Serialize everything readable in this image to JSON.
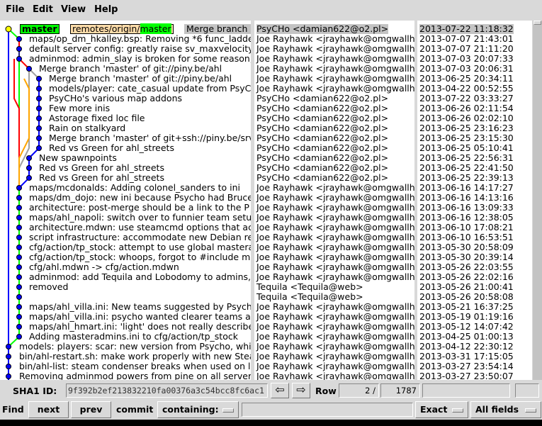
{
  "menu": [
    "File",
    "Edit",
    "View",
    "Help"
  ],
  "refs": {
    "head": "master",
    "remote_prefix": "remotes/origin/",
    "remote_branch": "master"
  },
  "commits": [
    {
      "subject": "Merge branch 'master' of piny.be:ahl",
      "author": "PsyCHo <damian622@o2.pl>",
      "date": "2013-07-22 11:18:32"
    },
    {
      "subject": "maps/op_dm_hkalley.bsp: Removing *6 func_ladder",
      "author": "Joe Rayhawk <jrayhawk@omgwallhack.org>",
      "date": "2013-07-07 21:43:01"
    },
    {
      "subject": "default server config: greatly raise sv_maxvelocity",
      "author": "Joe Rayhawk <jrayhawk@omgwallhack.org>",
      "date": "2013-07-07 21:11:20"
    },
    {
      "subject": "adminmod: admin_slay is broken for some reason;",
      "author": "Joe Rayhawk <jrayhawk@omgwallhack.org>",
      "date": "2013-07-03 20:07:33"
    },
    {
      "subject": "Merge branch 'master' of git://piny.be/ahl",
      "author": "Joe Rayhawk <jrayhawk@omgwallhack.org>",
      "date": "2013-07-03 20:06:31"
    },
    {
      "subject": "Merge branch 'master' of git://piny.be/ahl",
      "author": "Joe Rayhawk <jrayhawk@omgwallhack.org>",
      "date": "2013-06-25 20:34:11"
    },
    {
      "subject": "models/player: cate_casual update from PsyCHo",
      "author": "Joe Rayhawk <jrayhawk@omgwallhack.org>",
      "date": "2013-04-22 00:52:55"
    },
    {
      "subject": "PsyCHo's various map addons",
      "author": "PsyCHo <damian622@o2.pl>",
      "date": "2013-07-22 03:33:27"
    },
    {
      "subject": "Few more inis",
      "author": "PsyCHo <damian622@o2.pl>",
      "date": "2013-06-26 02:11:54"
    },
    {
      "subject": "Astorage fixed loc file",
      "author": "PsyCHo <damian622@o2.pl>",
      "date": "2013-06-26 02:02:10"
    },
    {
      "subject": "Rain on stalkyard",
      "author": "PsyCHo <damian622@o2.pl>",
      "date": "2013-06-25 23:16:23"
    },
    {
      "subject": "Merge branch 'master' of git+ssh://piny.be/srv",
      "author": "PsyCHo <damian622@o2.pl>",
      "date": "2013-06-25 23:15:30"
    },
    {
      "subject": "Red vs Green for ahl_streets",
      "author": "PsyCHo <damian622@o2.pl>",
      "date": "2013-06-25 05:10:41"
    },
    {
      "subject": "New spawnpoints",
      "author": "PsyCHo <damian622@o2.pl>",
      "date": "2013-06-25 22:56:31"
    },
    {
      "subject": "Red vs Green for ahl_streets",
      "author": "PsyCHo <damian622@o2.pl>",
      "date": "2013-06-25 22:41:50"
    },
    {
      "subject": "Red vs Green for ahl_streets",
      "author": "PsyCHo <damian622@o2.pl>",
      "date": "2013-06-25 22:39:13"
    },
    {
      "subject": "maps/mcdonalds: Adding colonel_sanders to ini",
      "author": "Joe Rayhawk <jrayhawk@omgwallhack.org>",
      "date": "2013-06-16 14:17:27"
    },
    {
      "subject": "maps/dm_dojo: new ini because Psycho had Bruce",
      "author": "Joe Rayhawk <jrayhawk@omgwallhack.org>",
      "date": "2013-06-16 14:13:16"
    },
    {
      "subject": "architecture: post-merge should be a link to the P",
      "author": "Joe Rayhawk <jrayhawk@omgwallhack.org>",
      "date": "2013-06-16 13:09:33"
    },
    {
      "subject": "maps/ahl_napoli: switch over to funnier team setup",
      "author": "Joe Rayhawk <jrayhawk@omgwallhack.org>",
      "date": "2013-06-16 12:38:05"
    },
    {
      "subject": "architecture.mdwn: use steamcmd options that ac",
      "author": "Joe Rayhawk <jrayhawk@omgwallhack.org>",
      "date": "2013-06-10 17:08:21"
    },
    {
      "subject": "script infrastructure: accommodate new Debian re",
      "author": "Joe Rayhawk <jrayhawk@omgwallhack.org>",
      "date": "2013-06-10 16:53:51"
    },
    {
      "subject": "cfg/action/tp_stock: attempt to use global mastera",
      "author": "Joe Rayhawk <jrayhawk@omgwallhack.org>",
      "date": "2013-05-30 20:58:09"
    },
    {
      "subject": "cfg/action/tp_stock: whoops, forgot to #include m",
      "author": "Joe Rayhawk <jrayhawk@omgwallhack.org>",
      "date": "2013-05-30 20:39:14"
    },
    {
      "subject": "cfg/ahl.mdwn -> cfg/action.mdwn",
      "author": "Joe Rayhawk <jrayhawk@omgwallhack.org>",
      "date": "2013-05-26 22:03:55"
    },
    {
      "subject": "adminmod: add Tequila and Lobodomy to admins,",
      "author": "Joe Rayhawk <jrayhawk@omgwallhack.org>",
      "date": "2013-05-26 22:02:16"
    },
    {
      "subject": "removed",
      "author": "Tequila <Tequila@web>",
      "date": "2013-05-26 21:00:41"
    },
    {
      "subject": "",
      "author": "Tequila <Tequila@web>",
      "date": "2013-05-26 20:58:08"
    },
    {
      "subject": "maps/ahl_villa.ini: New teams suggested by Psycho",
      "author": "Joe Rayhawk <jrayhawk@omgwallhack.org>",
      "date": "2013-05-21 16:37:25"
    },
    {
      "subject": "maps/ahl_villa.ini: psycho wanted clearer teams ar",
      "author": "Joe Rayhawk <jrayhawk@omgwallhack.org>",
      "date": "2013-05-19 01:19:16"
    },
    {
      "subject": "maps/ahl_hmart.ini: 'light' does not really describe",
      "author": "Joe Rayhawk <jrayhawk@omgwallhack.org>",
      "date": "2013-05-12 14:07:42"
    },
    {
      "subject": "Adding masteradmins.ini to cfg/action/tp_stock",
      "author": "Joe Rayhawk <jrayhawk@omgwallhack.org>",
      "date": "2013-04-25 01:00:13"
    },
    {
      "subject": "models: players: scar: new version from Psycho, which",
      "author": "Joe Rayhawk <jrayhawk@omgwallhack.org>",
      "date": "2013-04-12 22:30:12"
    },
    {
      "subject": "bin/ahl-restart.sh: make work properly with new Steam",
      "author": "Joe Rayhawk <jrayhawk@omgwallhack.org>",
      "date": "2013-03-31 17:15:05"
    },
    {
      "subject": "bin/ahl-list: steam condenser breaks when used on l",
      "author": "Joe Rayhawk <jrayhawk@omgwallhack.org>",
      "date": "2013-03-27 23:54:14"
    },
    {
      "subject": "Removing adminmod powers from pine on all servers",
      "author": "Joe Rayhawk <jrayhawk@omgwallhack.org>",
      "date": "2013-03-27 23:50:07"
    }
  ],
  "sha_bar": {
    "label": "SHA1 ID:",
    "sha": "9f392b2ef213832210fa00376a3c54bcc8fc6ac1",
    "back_icon": "left-arrow-icon",
    "forward_icon": "right-arrow-icon",
    "row_label": "Row",
    "row_current": "2",
    "row_sep": "/",
    "row_total": "1787"
  },
  "find_bar": {
    "find_label": "Find",
    "next": "next",
    "prev": "prev",
    "commit_label": "commit",
    "containing": "containing:",
    "match_mode": "Exact",
    "fields": "All fields"
  },
  "colors": {
    "head_ref": "#00ff00",
    "remote_ref": "#ffddaa",
    "line_blue": "#0000ff",
    "line_red": "#ff0000",
    "line_green": "#00ff00",
    "line_orange": "#ffa500",
    "line_gray": "#a0a0a0",
    "line_navy": "#202080"
  }
}
